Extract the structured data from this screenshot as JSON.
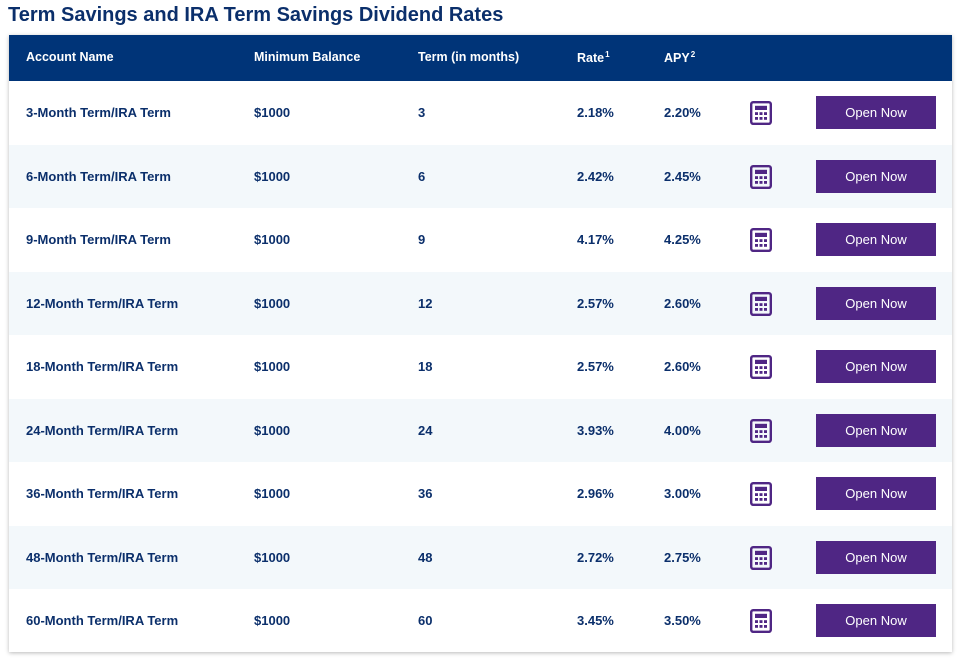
{
  "page": {
    "title": "Term Savings and IRA Term Savings Dividend Rates"
  },
  "table": {
    "headers": {
      "account_name": "Account Name",
      "minimum_balance": "Minimum Balance",
      "term": "Term (in months)",
      "rate": "Rate",
      "rate_footnote": "1",
      "apy": "APY",
      "apy_footnote": "2"
    },
    "rows": [
      {
        "account": "3-Month Term/IRA Term",
        "min_balance": "$1000",
        "term": "3",
        "rate": "2.18%",
        "apy": "2.20%",
        "button": "Open Now"
      },
      {
        "account": "6-Month Term/IRA Term",
        "min_balance": "$1000",
        "term": "6",
        "rate": "2.42%",
        "apy": "2.45%",
        "button": "Open Now"
      },
      {
        "account": "9-Month Term/IRA Term",
        "min_balance": "$1000",
        "term": "9",
        "rate": "4.17%",
        "apy": "4.25%",
        "button": "Open Now"
      },
      {
        "account": "12-Month Term/IRA Term",
        "min_balance": "$1000",
        "term": "12",
        "rate": "2.57%",
        "apy": "2.60%",
        "button": "Open Now"
      },
      {
        "account": "18-Month Term/IRA Term",
        "min_balance": "$1000",
        "term": "18",
        "rate": "2.57%",
        "apy": "2.60%",
        "button": "Open Now"
      },
      {
        "account": "24-Month Term/IRA Term",
        "min_balance": "$1000",
        "term": "24",
        "rate": "3.93%",
        "apy": "4.00%",
        "button": "Open Now"
      },
      {
        "account": "36-Month Term/IRA Term",
        "min_balance": "$1000",
        "term": "36",
        "rate": "2.96%",
        "apy": "3.00%",
        "button": "Open Now"
      },
      {
        "account": "48-Month Term/IRA Term",
        "min_balance": "$1000",
        "term": "48",
        "rate": "2.72%",
        "apy": "2.75%",
        "button": "Open Now"
      },
      {
        "account": "60-Month Term/IRA Term",
        "min_balance": "$1000",
        "term": "60",
        "rate": "3.45%",
        "apy": "3.50%",
        "button": "Open Now"
      }
    ],
    "row_icon": "calculator-icon"
  },
  "colors": {
    "header_bg": "#003478",
    "text": "#0b2f6b",
    "button_bg": "#4f2684",
    "icon": "#4f2684",
    "alt_row_bg": "#f3f8fb"
  }
}
